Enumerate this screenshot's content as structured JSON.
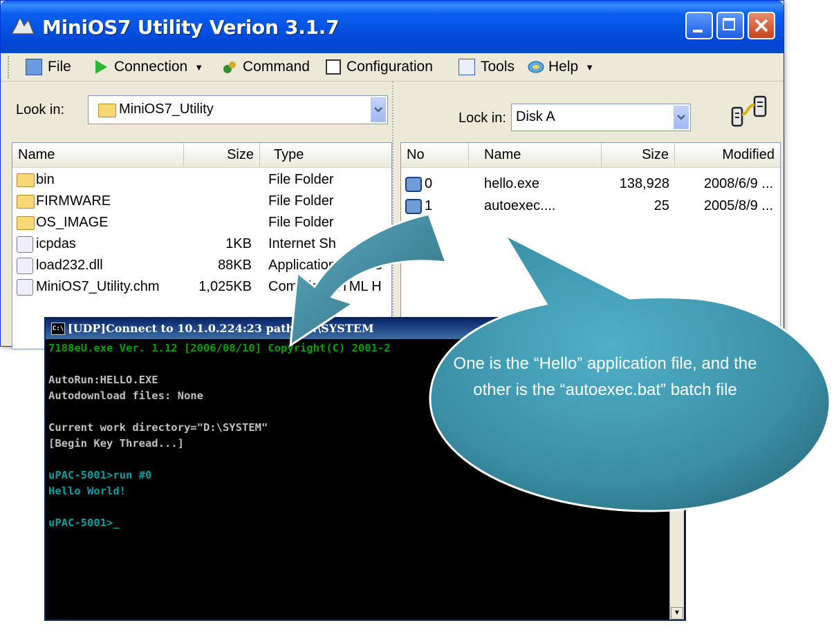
{
  "window": {
    "title": "MiniOS7 Utility Verion 3.1.7"
  },
  "menu": [
    {
      "label": "File",
      "icon": "file-icon"
    },
    {
      "label": "Connection",
      "icon": "play-icon",
      "dropdown": true
    },
    {
      "label": "Command",
      "icon": "command-icon"
    },
    {
      "label": "Configuration",
      "icon": "config-icon"
    },
    {
      "label": "Tools",
      "icon": "tools-icon"
    },
    {
      "label": "Help",
      "icon": "help-icon",
      "dropdown": true
    }
  ],
  "left_pane": {
    "look_in_label": "Look in:",
    "look_in_value": "MiniOS7_Utility",
    "columns": [
      "Name",
      "Size",
      "Type"
    ],
    "files": [
      {
        "name": "bin",
        "size": "",
        "type": "File Folder"
      },
      {
        "name": "FIRMWARE",
        "size": "",
        "type": "File Folder"
      },
      {
        "name": "OS_IMAGE",
        "size": "",
        "type": "File Folder"
      },
      {
        "name": "icpdas",
        "size": "1KB",
        "type": "Internet Sh"
      },
      {
        "name": "load232.dll",
        "size": "88KB",
        "type": "Application Extens"
      },
      {
        "name": "MiniOS7_Utility.chm",
        "size": "1,025KB",
        "type": "Compiled HTML H"
      }
    ]
  },
  "right_pane": {
    "look_in_label": "Lock in:",
    "look_in_value": "Disk A",
    "columns": [
      "No",
      "Name",
      "Size",
      "Modified"
    ],
    "files": [
      {
        "no": "0",
        "name": "hello.exe",
        "size": "138,928",
        "modified": "2008/6/9 ..."
      },
      {
        "no": "1",
        "name": "autoexec....",
        "size": "25",
        "modified": "2005/8/9 ..."
      }
    ]
  },
  "console": {
    "title": "[UDP]Connect to 10.1.0.224:23 path=D:\\SYSTEM",
    "lines": [
      {
        "text": "7188eU.exe Ver. 1.12 [2006/08/10] Copyright(C) 2001-2",
        "color": "green"
      },
      {
        "text": "",
        "color": "white"
      },
      {
        "text": "AutoRun:HELLO.EXE",
        "color": "white"
      },
      {
        "text": "Autodownload files: None",
        "color": "white"
      },
      {
        "text": "",
        "color": "white"
      },
      {
        "text": "Current work directory=\"D:\\SYSTEM\"",
        "color": "white"
      },
      {
        "text": "[Begin Key Thread...]",
        "color": "white"
      },
      {
        "text": "",
        "color": "white"
      },
      {
        "text": "uPAC-5001>run #0",
        "color": "cyan"
      },
      {
        "text": "Hello World!",
        "color": "cyan"
      },
      {
        "text": "",
        "color": "white"
      },
      {
        "text": "uPAC-5001>_",
        "color": "cyan"
      }
    ]
  },
  "callout": {
    "text": "One is the “Hello” application file, and the other is the “autoexec.bat” batch file"
  },
  "colors": {
    "titlebar": "#0054E3",
    "callout": "#3C8FA6",
    "console_bg": "#000000"
  }
}
